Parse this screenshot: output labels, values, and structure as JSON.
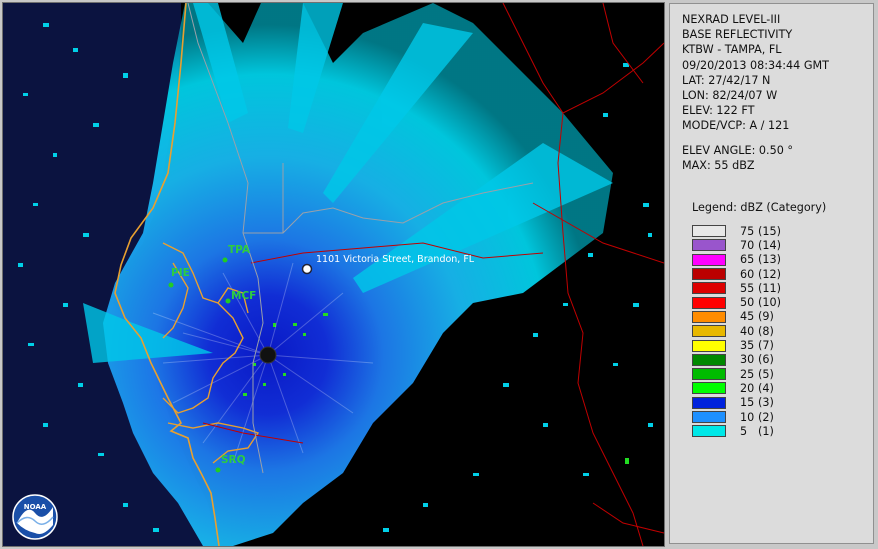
{
  "panel": {
    "product": "NEXRAD LEVEL-III",
    "type": "BASE REFLECTIVITY",
    "station": "KTBW - TAMPA, FL",
    "datetime": "09/20/2013 08:34:44 GMT",
    "lat": "LAT: 27/42/17 N",
    "lon": "LON: 82/24/07 W",
    "elev": "ELEV: 122 FT",
    "mode": "MODE/VCP: A / 121",
    "elev_angle": "ELEV ANGLE: 0.50 °",
    "max": "MAX: 55 dBZ"
  },
  "legend": {
    "title": "Legend: dBZ (Category)",
    "items": [
      {
        "value": "75",
        "cat": "(15)",
        "color": "#e8e8e8"
      },
      {
        "value": "70",
        "cat": "(14)",
        "color": "#9955cc"
      },
      {
        "value": "65",
        "cat": "(13)",
        "color": "#ff00ff"
      },
      {
        "value": "60",
        "cat": "(12)",
        "color": "#bb0000"
      },
      {
        "value": "55",
        "cat": "(11)",
        "color": "#dd0000"
      },
      {
        "value": "50",
        "cat": "(10)",
        "color": "#ff0000"
      },
      {
        "value": "45",
        "cat": "(9)",
        "color": "#ff8c00"
      },
      {
        "value": "40",
        "cat": "(8)",
        "color": "#e8b800"
      },
      {
        "value": "35",
        "cat": "(7)",
        "color": "#ffff00"
      },
      {
        "value": "30",
        "cat": "(6)",
        "color": "#008800"
      },
      {
        "value": "25",
        "cat": "(5)",
        "color": "#00bb00"
      },
      {
        "value": "20",
        "cat": "(4)",
        "color": "#00ff00"
      },
      {
        "value": "15",
        "cat": "(3)",
        "color": "#0022dd"
      },
      {
        "value": "10",
        "cat": "(2)",
        "color": "#1e90ff"
      },
      {
        "value": "5",
        "cat": "(1)",
        "color": "#00e8e8"
      }
    ]
  },
  "map": {
    "sites": [
      {
        "code": "TPA"
      },
      {
        "code": "PIE"
      },
      {
        "code": "MCF"
      },
      {
        "code": "SRQ"
      }
    ],
    "address": "1101 Victoria Street, Brandon, FL",
    "logo_text": "NOAA"
  }
}
